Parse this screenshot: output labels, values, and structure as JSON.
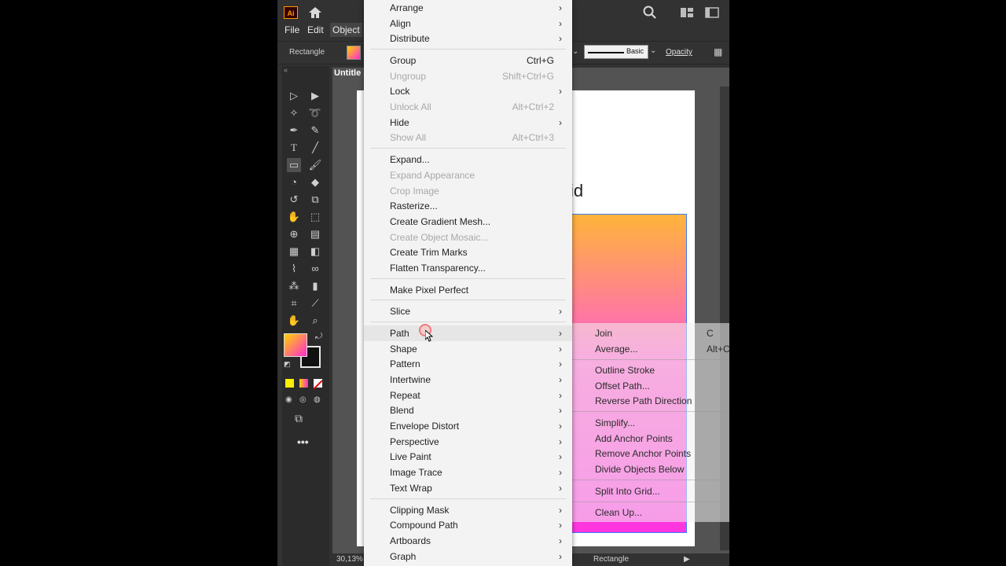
{
  "app": {
    "logo_text": "Ai",
    "menubar": [
      "File",
      "Edit",
      "Object"
    ],
    "control_label": "Rectangle",
    "stroke_style": "Basic",
    "opacity_label": "Opacity",
    "doc_tab": "Untitle",
    "zoom": "30,13%",
    "status_tool": "Rectangle",
    "artboard_text": "id",
    "accent": "#ff2bd1"
  },
  "menu": {
    "items": [
      {
        "label": "Arrange",
        "shortcut": "",
        "submenu": true,
        "disabled": false
      },
      {
        "label": "Align",
        "shortcut": "",
        "submenu": true,
        "disabled": false
      },
      {
        "label": "Distribute",
        "shortcut": "",
        "submenu": true,
        "disabled": false
      },
      {
        "label": "Group",
        "shortcut": "Ctrl+G",
        "submenu": false,
        "disabled": false
      },
      {
        "label": "Ungroup",
        "shortcut": "Shift+Ctrl+G",
        "submenu": false,
        "disabled": true
      },
      {
        "label": "Lock",
        "shortcut": "",
        "submenu": true,
        "disabled": false
      },
      {
        "label": "Unlock All",
        "shortcut": "Alt+Ctrl+2",
        "submenu": false,
        "disabled": true
      },
      {
        "label": "Hide",
        "shortcut": "",
        "submenu": true,
        "disabled": false
      },
      {
        "label": "Show All",
        "shortcut": "Alt+Ctrl+3",
        "submenu": false,
        "disabled": true
      },
      {
        "label": "Expand...",
        "shortcut": "",
        "submenu": false,
        "disabled": false
      },
      {
        "label": "Expand Appearance",
        "shortcut": "",
        "submenu": false,
        "disabled": true
      },
      {
        "label": "Crop Image",
        "shortcut": "",
        "submenu": false,
        "disabled": true
      },
      {
        "label": "Rasterize...",
        "shortcut": "",
        "submenu": false,
        "disabled": false
      },
      {
        "label": "Create Gradient Mesh...",
        "shortcut": "",
        "submenu": false,
        "disabled": false
      },
      {
        "label": "Create Object Mosaic...",
        "shortcut": "",
        "submenu": false,
        "disabled": true
      },
      {
        "label": "Create Trim Marks",
        "shortcut": "",
        "submenu": false,
        "disabled": false
      },
      {
        "label": "Flatten Transparency...",
        "shortcut": "",
        "submenu": false,
        "disabled": false
      },
      {
        "label": "Make Pixel Perfect",
        "shortcut": "",
        "submenu": false,
        "disabled": false
      },
      {
        "label": "Slice",
        "shortcut": "",
        "submenu": true,
        "disabled": false
      },
      {
        "label": "Path",
        "shortcut": "",
        "submenu": true,
        "disabled": false,
        "highlighted": true
      },
      {
        "label": "Shape",
        "shortcut": "",
        "submenu": true,
        "disabled": false
      },
      {
        "label": "Pattern",
        "shortcut": "",
        "submenu": true,
        "disabled": false
      },
      {
        "label": "Intertwine",
        "shortcut": "",
        "submenu": true,
        "disabled": false
      },
      {
        "label": "Repeat",
        "shortcut": "",
        "submenu": true,
        "disabled": false
      },
      {
        "label": "Blend",
        "shortcut": "",
        "submenu": true,
        "disabled": false
      },
      {
        "label": "Envelope Distort",
        "shortcut": "",
        "submenu": true,
        "disabled": false
      },
      {
        "label": "Perspective",
        "shortcut": "",
        "submenu": true,
        "disabled": false
      },
      {
        "label": "Live Paint",
        "shortcut": "",
        "submenu": true,
        "disabled": false
      },
      {
        "label": "Image Trace",
        "shortcut": "",
        "submenu": true,
        "disabled": false
      },
      {
        "label": "Text Wrap",
        "shortcut": "",
        "submenu": true,
        "disabled": false
      },
      {
        "label": "Clipping Mask",
        "shortcut": "",
        "submenu": true,
        "disabled": false
      },
      {
        "label": "Compound Path",
        "shortcut": "",
        "submenu": true,
        "disabled": false
      },
      {
        "label": "Artboards",
        "shortcut": "",
        "submenu": true,
        "disabled": false
      },
      {
        "label": "Graph",
        "shortcut": "",
        "submenu": true,
        "disabled": false
      }
    ]
  },
  "path_submenu": {
    "items": [
      {
        "label": "Join",
        "shortcut": "C"
      },
      {
        "label": "Average...",
        "shortcut": "Alt+C"
      },
      {
        "label": "Outline Stroke",
        "shortcut": ""
      },
      {
        "label": "Offset Path...",
        "shortcut": ""
      },
      {
        "label": "Reverse Path Direction",
        "shortcut": ""
      },
      {
        "label": "Simplify...",
        "shortcut": ""
      },
      {
        "label": "Add Anchor Points",
        "shortcut": ""
      },
      {
        "label": "Remove Anchor Points",
        "shortcut": ""
      },
      {
        "label": "Divide Objects Below",
        "shortcut": ""
      },
      {
        "label": "Split Into Grid...",
        "shortcut": ""
      },
      {
        "label": "Clean Up...",
        "shortcut": ""
      }
    ]
  },
  "icons": {
    "home": "home-icon",
    "search": "search-icon",
    "arrange_docs": "arrange-documents-icon",
    "panel": "panel-icon",
    "more_tools": "more-tools-icon"
  }
}
